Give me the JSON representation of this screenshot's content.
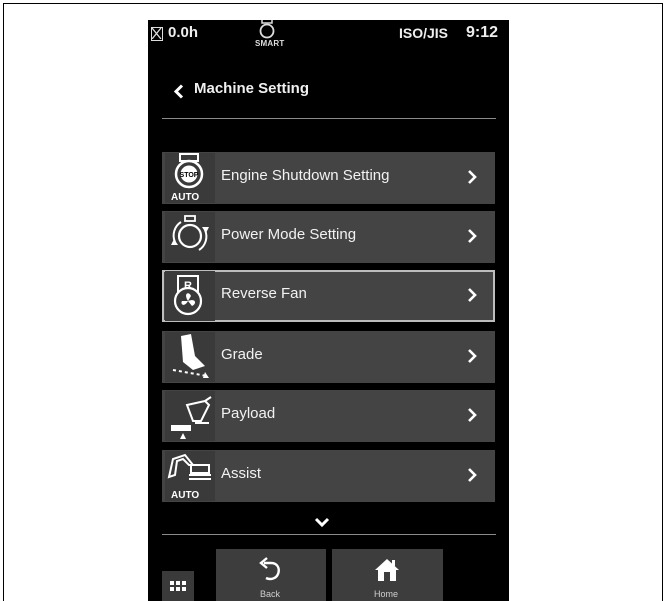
{
  "status_bar": {
    "hour_meter": "0.0h",
    "mode_label": "SMART",
    "standard": "ISO/JIS",
    "clock": "9:12"
  },
  "header": {
    "title": "Machine Setting"
  },
  "menu": {
    "items": [
      {
        "label": "Engine Shutdown Setting",
        "icon": "engine-stop-auto-icon",
        "badge": "AUTO",
        "selected": false
      },
      {
        "label": "Power Mode Setting",
        "icon": "power-mode-icon",
        "badge": "",
        "selected": false
      },
      {
        "label": "Reverse Fan",
        "icon": "reverse-fan-icon",
        "badge": "",
        "selected": true
      },
      {
        "label": "Grade",
        "icon": "grade-icon",
        "badge": "",
        "selected": false
      },
      {
        "label": "Payload",
        "icon": "payload-icon",
        "badge": "",
        "selected": false
      },
      {
        "label": "Assist",
        "icon": "excavator-assist-icon",
        "badge": "AUTO",
        "selected": false
      }
    ]
  },
  "bottom_bar": {
    "back_label": "Back",
    "home_label": "Home"
  },
  "colors": {
    "screen_background": "#000000",
    "item_background": "#444444",
    "selected_border": "#bdbdbd",
    "text": "#f2f2f2"
  }
}
